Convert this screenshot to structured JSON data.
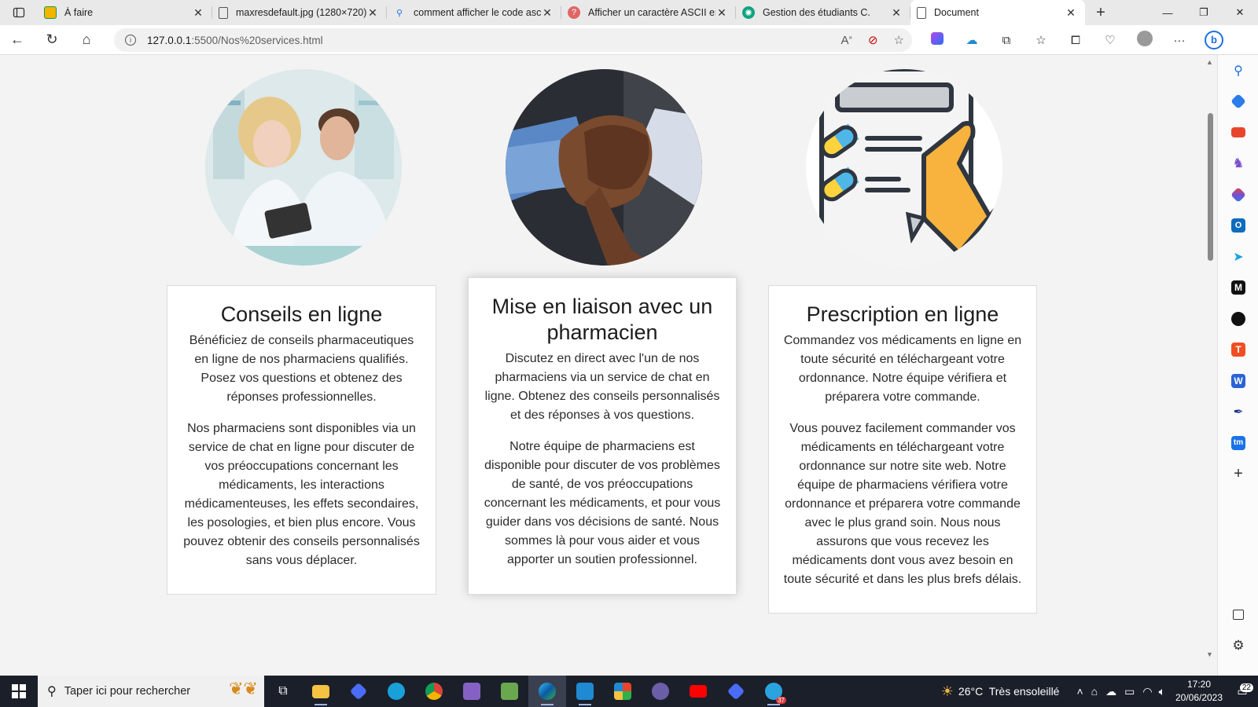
{
  "browser": {
    "tabs": [
      {
        "title": "À faire",
        "icon": "google-classroom-icon",
        "color": "#f4b400"
      },
      {
        "title": "maxresdefault.jpg (1280×720)",
        "icon": "document-icon",
        "color": "#555555"
      },
      {
        "title": "comment afficher le code ascii",
        "icon": "search-icon",
        "color": "#1a73e8"
      },
      {
        "title": "Afficher un caractère ASCII en",
        "icon": "question-icon",
        "color": "#d9534f"
      },
      {
        "title": "Gestion des étudiants C.",
        "icon": "chatgpt-icon",
        "color": "#10a37f"
      },
      {
        "title": "Document",
        "icon": "document-icon",
        "color": "#555555",
        "active": true
      }
    ],
    "url_host": "127.0.0.1",
    "url_rest": ":5500/Nos%20services.html"
  },
  "services": [
    {
      "title": "Conseils en ligne",
      "paragraphs": [
        "Bénéficiez de conseils pharmaceutiques en ligne de nos pharmaciens qualifiés. Posez vos questions et obtenez des réponses professionnelles.",
        "Nos pharmaciens sont disponibles via un service de chat en ligne pour discuter de vos préoccupations concernant les médicaments, les interactions médicamenteuses, les effets secondaires, les posologies, et bien plus encore. Vous pouvez obtenir des conseils personnalisés sans vous déplacer."
      ]
    },
    {
      "title": "Mise en liaison avec un pharmacien",
      "paragraphs": [
        "Discutez en direct avec l'un de nos pharmaciens via un service de chat en ligne. Obtenez des conseils personnalisés et des réponses à vos questions.",
        "Notre équipe de pharmaciens est disponible pour discuter de vos problèmes de santé, de vos préoccupations concernant les médicaments, et pour vous guider dans vos décisions de santé. Nous sommes là pour vous aider et vous apporter un soutien professionnel."
      ]
    },
    {
      "title": "Prescription en ligne",
      "paragraphs": [
        "Commandez vos médicaments en ligne en toute sécurité en téléchargeant votre ordonnance. Notre équipe vérifiera et préparera votre commande.",
        "Vous pouvez facilement commander vos médicaments en téléchargeant votre ordonnance sur notre site web. Notre équipe de pharmaciens vérifiera votre ordonnance et préparera votre commande avec le plus grand soin. Nous nous assurons que vous recevez les médicaments dont vous avez besoin en toute sécurité et dans les plus brefs délais."
      ]
    }
  ],
  "taskbar": {
    "search_placeholder": "Taper ici pour rechercher",
    "weather": "26°C  Très ensoleillé",
    "time": "17:20",
    "date": "20/06/2023",
    "notifications": "22",
    "telegram_badge": "37"
  }
}
